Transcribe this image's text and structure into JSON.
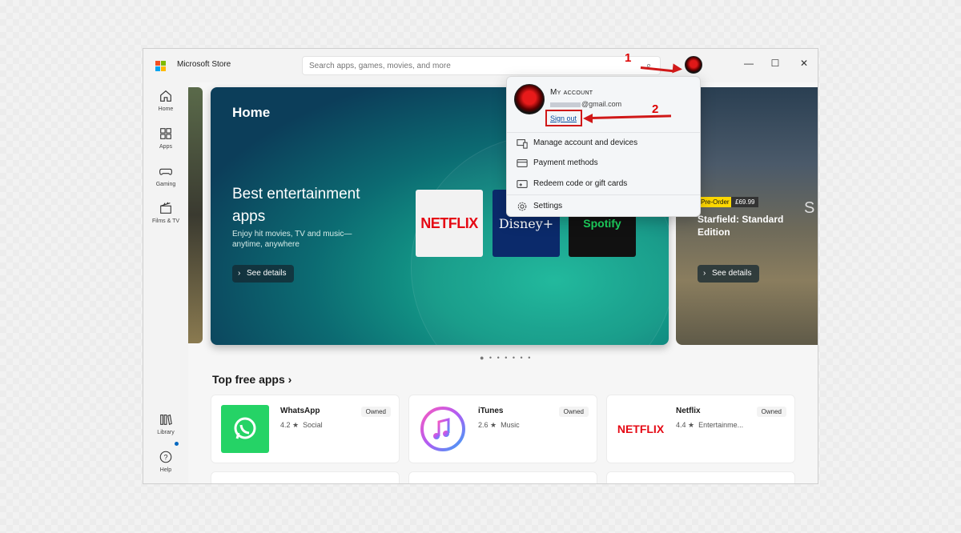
{
  "window": {
    "app_title": "Microsoft Store"
  },
  "search": {
    "placeholder": "Search apps, games, movies, and more"
  },
  "annotations": {
    "step1": "1",
    "step2": "2"
  },
  "sidebar": {
    "items": [
      {
        "label": "Home",
        "icon": "home-icon"
      },
      {
        "label": "Apps",
        "icon": "apps-icon"
      },
      {
        "label": "Gaming",
        "icon": "gamepad-icon"
      },
      {
        "label": "Films & TV",
        "icon": "clapperboard-icon"
      },
      {
        "label": "Library",
        "icon": "library-icon"
      },
      {
        "label": "Help",
        "icon": "help-icon"
      }
    ]
  },
  "hero": {
    "page_title": "Home",
    "title": "Best entertainment apps",
    "description": "Enjoy hit movies, TV and music—anytime, anywhere",
    "button": "See details",
    "tiles": [
      "NETFLIX",
      "Disney+",
      "Spotify"
    ]
  },
  "hero_next": {
    "badge": "Pre-Order",
    "price": "£69.99",
    "title": "Starfield: Standard Edition",
    "button": "See details",
    "partial_letter": "S"
  },
  "carousel": {
    "dots": "● • • • • • •"
  },
  "top_free": {
    "title": "Top free apps",
    "apps": [
      {
        "name": "WhatsApp",
        "rating": "4.2 ★",
        "category": "Social",
        "status": "Owned"
      },
      {
        "name": "iTunes",
        "rating": "2.6 ★",
        "category": "Music",
        "status": "Owned"
      },
      {
        "name": "Netflix",
        "rating": "4.4 ★",
        "category": "Entertainme...",
        "status": "Owned"
      }
    ]
  },
  "account_menu": {
    "title": "My account",
    "email_suffix": "@gmail.com",
    "sign_out": "Sign out",
    "items": [
      {
        "label": "Manage account and devices",
        "icon": "devices-icon"
      },
      {
        "label": "Payment methods",
        "icon": "credit-card-icon"
      },
      {
        "label": "Redeem code or gift cards",
        "icon": "gift-card-icon"
      },
      {
        "label": "Settings",
        "icon": "gear-icon"
      }
    ]
  },
  "colors": {
    "annotation_red": "#d01818",
    "accent": "#0067c0",
    "whatsapp": "#25d366",
    "netflix": "#e50914"
  }
}
